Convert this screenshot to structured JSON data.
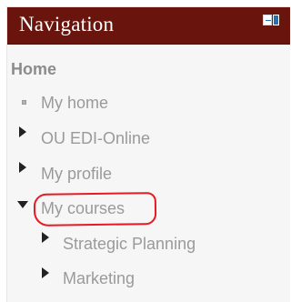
{
  "header": {
    "title": "Navigation",
    "dock_icon": "dock-icon",
    "hide_icon": "hide-block-icon"
  },
  "nav": {
    "home": "Home",
    "items": [
      {
        "label": "My home",
        "icon": "bullet-icon"
      },
      {
        "label": "OU EDI-Online",
        "icon": "expand-arrow-icon"
      },
      {
        "label": "My profile",
        "icon": "expand-arrow-icon"
      },
      {
        "label": "My courses",
        "icon": "collapse-arrow-icon",
        "expanded": true,
        "highlighted": true
      }
    ],
    "courses": [
      {
        "label": "Strategic Planning",
        "icon": "expand-arrow-icon"
      },
      {
        "label": "Marketing",
        "icon": "expand-arrow-icon"
      }
    ]
  },
  "colors": {
    "header_bg": "#69150e",
    "highlight": "#e51b23",
    "text": "#9a9a9a"
  }
}
